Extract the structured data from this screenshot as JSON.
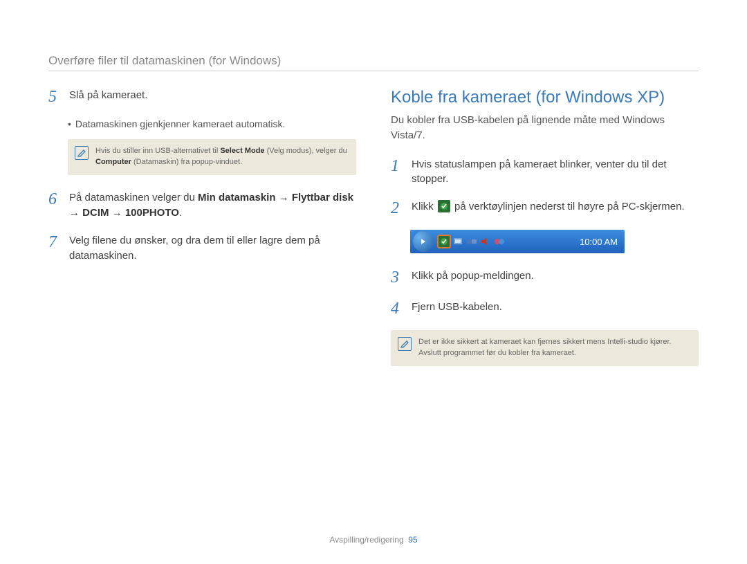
{
  "breadcrumb": "Overføre filer til datamaskinen (for Windows)",
  "left": {
    "step5": {
      "num": "5",
      "text": "Slå på kameraet."
    },
    "step5_bullet": "Datamaskinen gjenkjenner kameraet automatisk.",
    "note5_a": "Hvis du stiller inn USB-alternativet til ",
    "note5_b": "Select Mode",
    "note5_c": " (Velg modus), velger du ",
    "note5_d": "Computer",
    "note5_e": " (Datamaskin) fra popup-vinduet.",
    "step6": {
      "num": "6",
      "text_a": "På datamaskinen velger du ",
      "text_b": "Min datamaskin → Flyttbar disk → DCIM → 100PHOTO",
      "text_c": "."
    },
    "step7": {
      "num": "7",
      "text": "Velg filene du ønsker, og dra dem til eller lagre dem på datamaskinen."
    }
  },
  "right": {
    "title": "Koble fra kameraet (for Windows XP)",
    "intro": "Du kobler fra USB-kabelen på lignende måte med Windows Vista/7.",
    "step1": {
      "num": "1",
      "text": "Hvis statuslampen på kameraet blinker, venter du til det stopper."
    },
    "step2": {
      "num": "2",
      "text_a": "Klikk ",
      "text_b": " på verktøylinjen nederst til høyre på PC-skjermen."
    },
    "taskbar": {
      "clock": "10:00 AM"
    },
    "step3": {
      "num": "3",
      "text": "Klikk på popup-meldingen."
    },
    "step4": {
      "num": "4",
      "text": "Fjern USB-kabelen."
    },
    "note": "Det er ikke sikkert at kameraet kan fjernes sikkert mens Intelli-studio kjører. Avslutt programmet før du kobler fra kameraet."
  },
  "footer": {
    "section": "Avspilling/redigering",
    "page": "95"
  }
}
